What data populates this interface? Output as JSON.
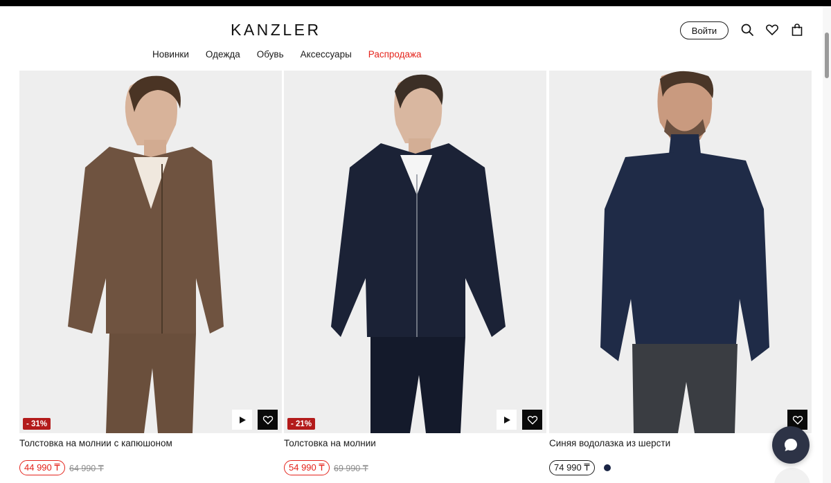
{
  "header": {
    "logo": "KANZLER",
    "login_label": "Войти",
    "nav": [
      {
        "label": "Новинки",
        "highlight": false
      },
      {
        "label": "Одежда",
        "highlight": false
      },
      {
        "label": "Обувь",
        "highlight": false
      },
      {
        "label": "Аксессуары",
        "highlight": false
      },
      {
        "label": "Распродажа",
        "highlight": true
      }
    ],
    "icons": [
      "search-icon",
      "heart-icon",
      "bag-icon"
    ]
  },
  "products": [
    {
      "name": "Толстовка на молнии с капюшоном",
      "discount": "- 31%",
      "price": "44 990 ₸",
      "old_price": "64 990 ₸",
      "has_video": true,
      "on_sale": true,
      "color": "#6f5340"
    },
    {
      "name": "Толстовка на молнии",
      "discount": "- 21%",
      "price": "54 990 ₸",
      "old_price": "69 990 ₸",
      "has_video": true,
      "on_sale": true,
      "color": "#1b2236"
    },
    {
      "name": "Синяя водолазка из шерсти",
      "price": "74 990 ₸",
      "has_video": false,
      "on_sale": false,
      "color": "#1f2b47",
      "swatch_color": "#1a2545"
    }
  ],
  "colors": {
    "sale": "#e4231b",
    "discount_badge": "#b31b1b",
    "chat_button": "#2d3346"
  }
}
